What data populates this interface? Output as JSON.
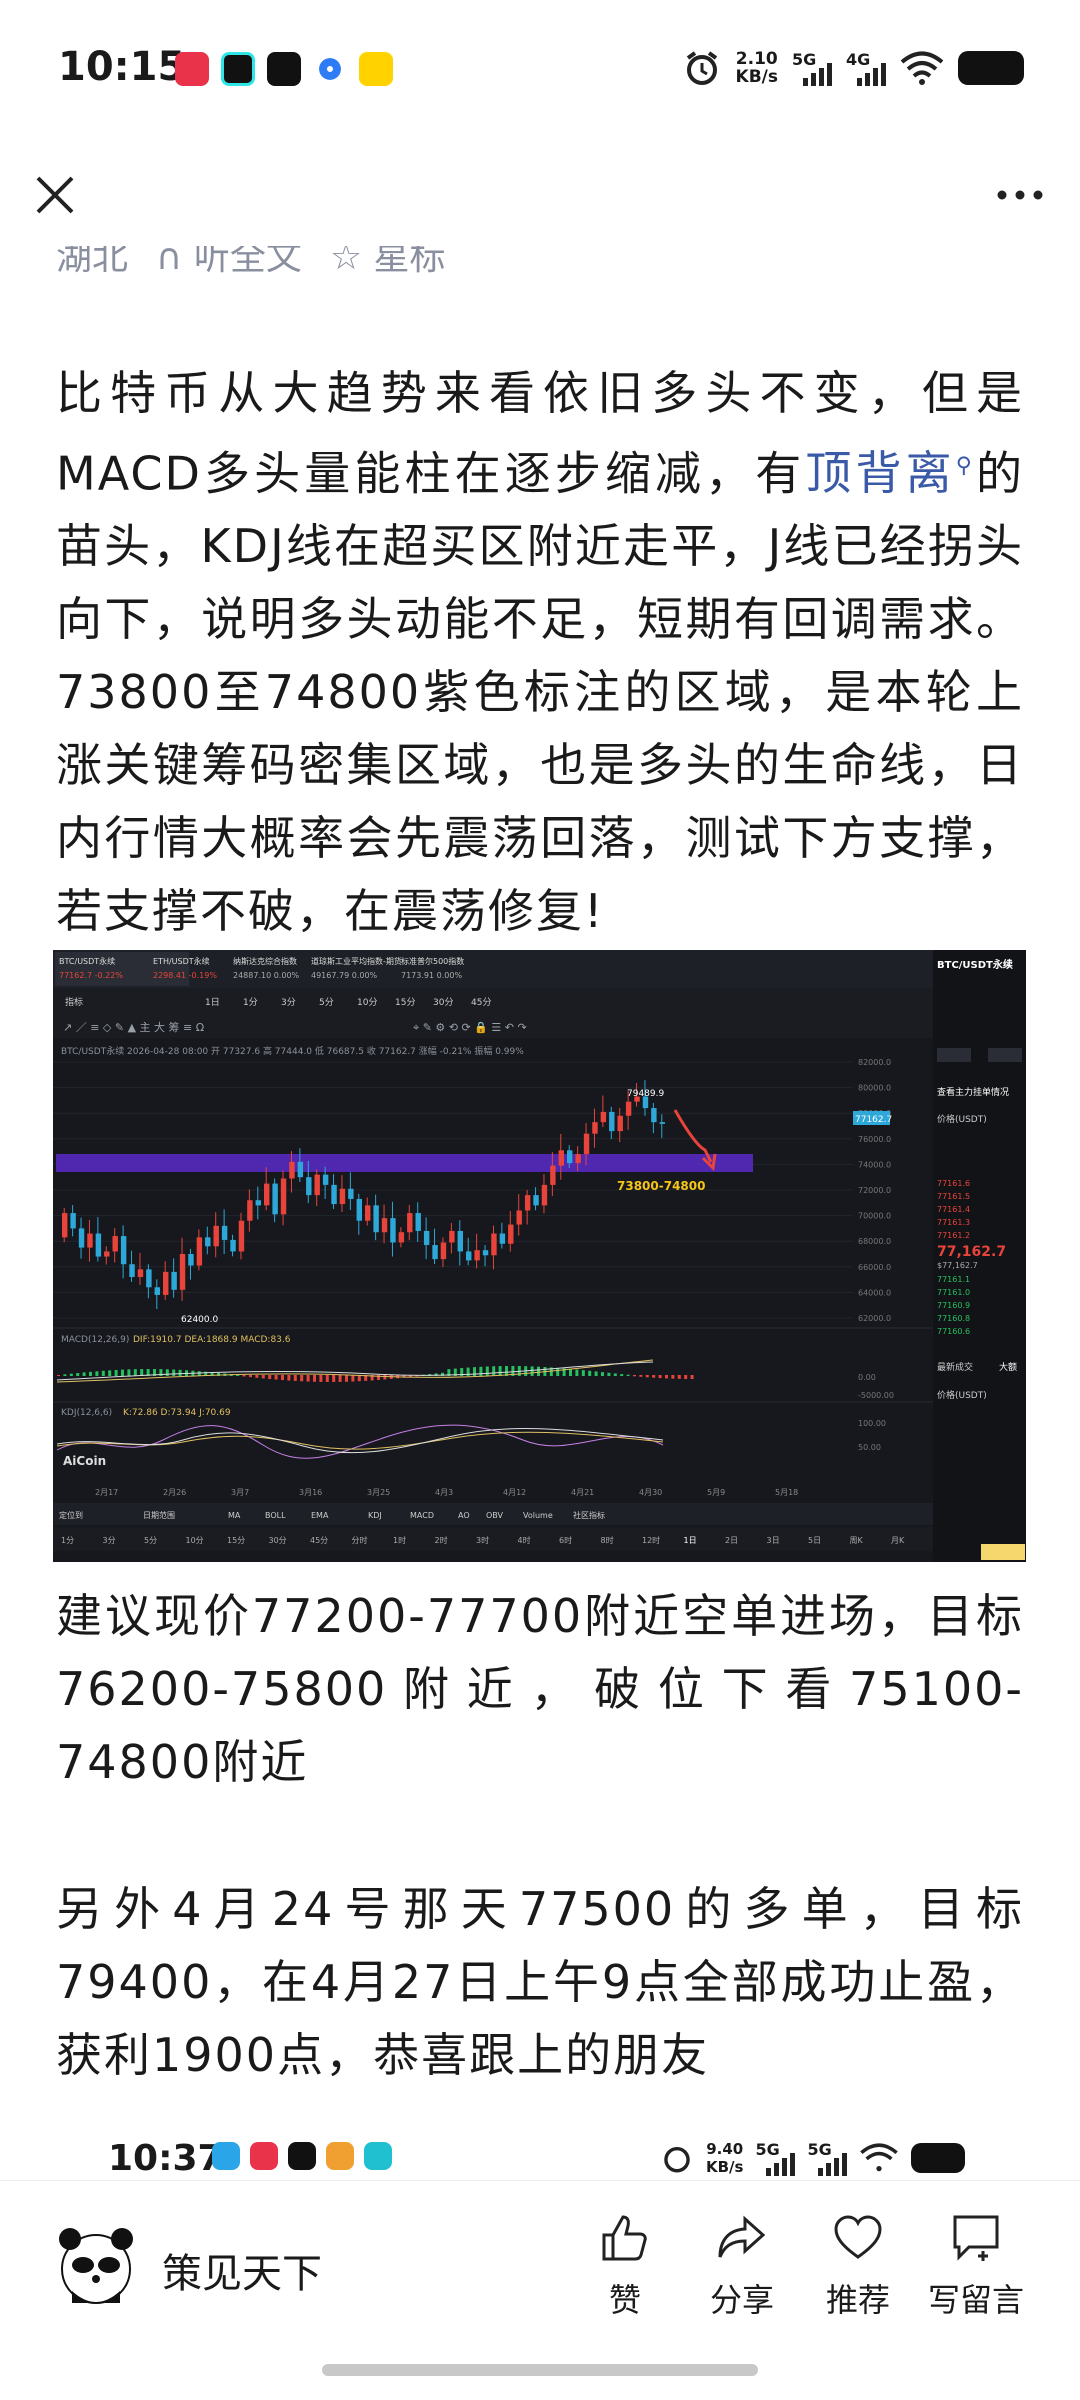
{
  "status_bar": {
    "time": "10:15",
    "net_speed": "2.10",
    "net_unit": "KB/s",
    "sig1": "5G",
    "sig2": "4G"
  },
  "article": {
    "header_faded": [
      "湖北",
      "听全文",
      "星标"
    ],
    "para1_a": "比特币从大趋势来看依旧多头不变，但是MACD多头量能柱在逐步缩减，有",
    "para1_link": "顶背离",
    "para1_b": "的苗头，KDJ线在超买区附近走平，J线已经拐头向下，说明多头动能不足，短期有回调需求。73800至74800紫色标注的区域，是本轮上涨关键筹码密集区域，也是多头的生命线，日内行情大概率会先震荡回落，测试下方支撑，若支撑不破，在震荡修复!",
    "para2": "建议现价77200-77700附近空单进场，目标76200-75800附近，破位下看75100-74800附近",
    "para3": "另外4月24号那天77500的多单，目标79400，在4月27日上午9点全部成功止盈，获利1900点，恭喜跟上的朋友"
  },
  "chart_image": {
    "tabs": [
      "BTC/USDT永续",
      "ETH/USDT永续",
      "纳斯达克综合指数",
      "道琼斯工业平均指数-期货",
      "标准普尔500指数"
    ],
    "tab_values": [
      "77162.7 -0.22%",
      "2298.41 -0.19%",
      "24887.10 0.00%",
      "49167.79 0.00%",
      "7173.91 0.00%"
    ],
    "toolbar_items": [
      "指标",
      "1日",
      "1分",
      "3分",
      "5分",
      "10分",
      "15分",
      "30分",
      "45分"
    ],
    "info_line": "BTC/USDT永续 2026-04-28 08:00 开 77327.6 高 77444.0 低 76687.5 收 77162.7 涨幅 -0.21% 振幅 0.99%",
    "price_ticks": [
      "82000.0",
      "80000.0",
      "78000.0",
      "76000.0",
      "74000.0",
      "72000.0",
      "70000.0",
      "68000.0",
      "66000.0",
      "64000.0",
      "62000.0"
    ],
    "current_price_tag": "77162.7",
    "high_label": "79489.9",
    "low_label": "62400.0",
    "zone_label": "73800-74800",
    "macd_label": "MACD(12,26,9)",
    "macd_values": "DIF:1910.7  DEA:1868.9  MACD:83.6",
    "kdj_label": "KDJ(12,6,6)",
    "kdj_values": "K:72.86  D:73.94  J:70.69",
    "watermark": "AiCoin",
    "date_ticks": [
      "2月17",
      "2月26",
      "3月7",
      "3月16",
      "3月25",
      "4月3",
      "4月12",
      "4月21",
      "4月30",
      "5月9",
      "5月18"
    ],
    "indicator_tabs": [
      "定位到",
      "日期范围",
      "MA",
      "BOLL",
      "EMA",
      "KDJ",
      "MACD",
      "AO",
      "OBV",
      "Volume",
      "社区指标"
    ],
    "period_tabs": [
      "1分",
      "3分",
      "5分",
      "10分",
      "15分",
      "30分",
      "45分",
      "分时",
      "1时",
      "2时",
      "3时",
      "4时",
      "6时",
      "8时",
      "12时",
      "1日",
      "2日",
      "3日",
      "5日",
      "周K",
      "月K"
    ],
    "side_title": "BTC/USDT永续",
    "side_subtitle": "查看主力挂单情况",
    "side_price": "77,162.7",
    "side_price_sub": "$77,162.7",
    "side_label1": "价格(USDT)",
    "side_label2": "最新成交",
    "side_label3": "大额",
    "side_asks": [
      "77161.6",
      "77161.5",
      "77161.4",
      "77161.3",
      "77161.2"
    ],
    "side_bids": [
      "77161.1",
      "77161.0",
      "77160.9",
      "77160.8",
      "77160.6"
    ]
  },
  "snapshot_bar": {
    "time": "10:37",
    "speed": "9.40",
    "speed_unit": "KB/s"
  },
  "bottom_bar": {
    "author": "策见天下",
    "actions": [
      "赞",
      "分享",
      "推荐",
      "写留言"
    ]
  },
  "colors": {
    "accent_link": "#3a5aa8",
    "up": "#e8443b",
    "down": "#2ea8d8",
    "zone": "#5b2ac9",
    "label_yellow": "#f5c518"
  }
}
